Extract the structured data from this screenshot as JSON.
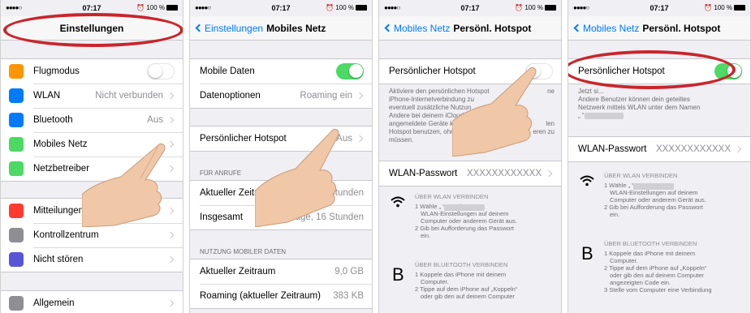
{
  "status": {
    "signal": "●●●●○",
    "time": "07:17",
    "battery": "100 %"
  },
  "screen1": {
    "title": "Einstellungen",
    "rows1": [
      {
        "label": "Flugmodus",
        "value": "",
        "type": "toggle-off",
        "icon": "airplane-icon",
        "color": "#ff9500"
      },
      {
        "label": "WLAN",
        "value": "Nicht verbunden",
        "type": "arrow",
        "icon": "wifi-icon",
        "color": "#007aff"
      },
      {
        "label": "Bluetooth",
        "value": "Aus",
        "type": "arrow",
        "icon": "bluetooth-icon",
        "color": "#007aff"
      },
      {
        "label": "Mobiles Netz",
        "value": "",
        "type": "arrow",
        "icon": "antenna-icon",
        "color": "#4cd964"
      },
      {
        "label": "Netzbetreiber",
        "value": "",
        "type": "arrow",
        "icon": "phone-icon",
        "color": "#4cd964"
      }
    ],
    "rows2": [
      {
        "label": "Mitteilungen",
        "icon": "notifications-icon",
        "color": "#ff3b30"
      },
      {
        "label": "Kontrollzentrum",
        "icon": "control-center-icon",
        "color": "#8e8e93"
      },
      {
        "label": "Nicht stören",
        "icon": "moon-icon",
        "color": "#5856d6"
      }
    ],
    "rows3": [
      {
        "label": "Allgemein",
        "icon": "gear-icon",
        "color": "#8e8e93"
      }
    ]
  },
  "screen2": {
    "back": "Einstellungen",
    "title": "Mobiles Netz",
    "rows1": [
      {
        "label": "Mobile Daten",
        "value": "",
        "type": "toggle-on"
      },
      {
        "label": "Datenoptionen",
        "value": "Roaming ein",
        "type": "arrow"
      }
    ],
    "rows2": [
      {
        "label": "Persönlicher Hotspot",
        "value": "Aus",
        "type": "arrow"
      }
    ],
    "section_calls": "FÜR ANRUFE",
    "rows3": [
      {
        "label": "Aktueller Zeitra",
        "value": "Stunden",
        "type": "none"
      },
      {
        "label": "Insgesamt",
        "value": "Tage, 16 Stunden",
        "type": "none"
      }
    ],
    "section_usage": "NUTZUNG MOBILER DATEN",
    "rows4": [
      {
        "label": "Aktueller Zeitraum",
        "value": "9,0 GB",
        "type": "none"
      },
      {
        "label": "Roaming (aktueller Zeitraum)",
        "value": "383 KB",
        "type": "none"
      }
    ]
  },
  "screen3": {
    "back": "Mobiles Netz",
    "title": "Persönl. Hotspot",
    "hotspot_label": "Persönlicher Hotspot",
    "description": "Aktiviere den persönlichen Hotspot ... iPhone-Internetverbindung zu ... eventuell zusätzliche Nutzun... Andere bei deinem iCloud-A... angemeldete Geräte könn... Hotspot benutzen, ohn... müssen.",
    "desc_lines": [
      "Aktiviere den persönlichen Hotspot",
      "iPhone-Internetverbindung zu",
      "eventuell zusätzliche Nutzun",
      "Andere bei deinem iCloud-A",
      "angemeldete Geräte könn",
      "Hotspot benutzen, ohn",
      "müssen."
    ],
    "desc_tail": [
      "ne",
      "",
      "",
      "",
      "len",
      "eren zu",
      ""
    ],
    "wlan_label": "WLAN-Passwort",
    "wlan_value": "XXXXXXXXXXXX",
    "wifi_title": "ÜBER WLAN VERBINDEN",
    "wifi_steps": [
      "1 Wähle „                 “ von den",
      "WLAN-Einstellungen auf deinem",
      "Computer oder anderem Gerät aus.",
      "2 Gib bei Aufforderung das Passwort",
      "ein."
    ],
    "bt_title": "ÜBER BLUETOOTH VERBINDEN",
    "bt_steps": [
      "1 Koppele das iPhone mit deinem",
      "Computer.",
      "2 Tippe auf dem iPhone auf „Koppeln“",
      "oder gib den auf deinem Computer"
    ]
  },
  "screen4": {
    "back": "Mobiles Netz",
    "title": "Persönl. Hotspot",
    "hotspot_label": "Persönlicher Hotspot",
    "desc_lines": [
      "Jetzt si...",
      "Andere Benutzer können dein geteiltes",
      "Netzwerk mittels WLAN unter dem Namen",
      "„                “ finden."
    ],
    "wlan_label": "WLAN-Passwort",
    "wlan_value": "XXXXXXXXXXXX",
    "wifi_title": "ÜBER WLAN VERBINDEN",
    "wifi_steps": [
      "1 Wähle „                 “ von den",
      "WLAN-Einstellungen auf deinem",
      "Computer oder anderem Gerät aus.",
      "2 Gib bei Aufforderung das Passwort",
      "ein."
    ],
    "bt_title": "ÜBER BLUETOOTH VERBINDEN",
    "bt_steps": [
      "1 Koppele das iPhone mit deinem",
      "Computer.",
      "2 Tippe auf dem iPhone auf „Koppeln“",
      "oder gib den auf deinem Computer",
      "angezeigten Code ein.",
      "3 Stelle vom Computer eine Verbindung"
    ]
  },
  "colors": {
    "accent": "#007aff",
    "toggle_on": "#4cd964",
    "highlight": "#c9252c"
  }
}
